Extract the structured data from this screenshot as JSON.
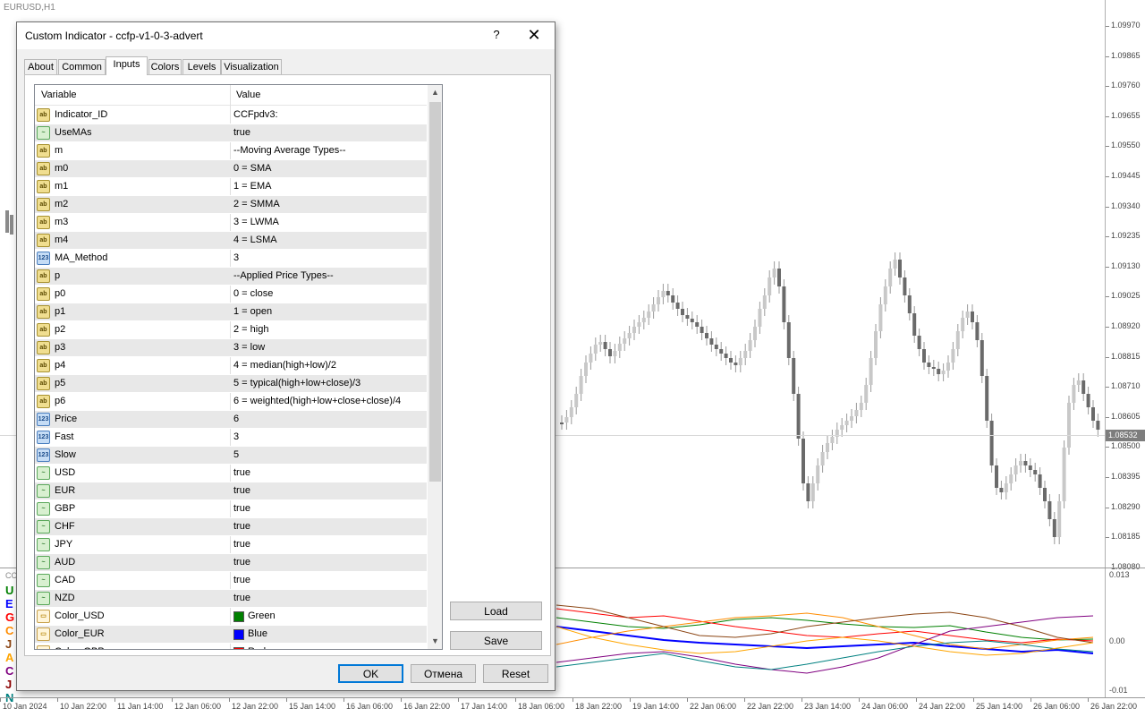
{
  "chart": {
    "symbol": "EURUSD,H1",
    "current_price": "1.08532",
    "price_ticks": [
      "1.09970",
      "1.09865",
      "1.09760",
      "1.09655",
      "1.09550",
      "1.09445",
      "1.09340",
      "1.09235",
      "1.09130",
      "1.09025",
      "1.08920",
      "1.08815",
      "1.08710",
      "1.08605",
      "1.08500",
      "1.08395",
      "1.08290",
      "1.08185",
      "1.08080"
    ],
    "subwindow_ticks": [
      "0.013",
      "0.00",
      "-0.01"
    ],
    "time_ticks": [
      "10 Jan 2024",
      "10 Jan 22:00",
      "11 Jan 14:00",
      "12 Jan 06:00",
      "12 Jan 22:00",
      "15 Jan 14:00",
      "16 Jan 06:00",
      "16 Jan 22:00",
      "17 Jan 14:00",
      "18 Jan 06:00",
      "18 Jan 22:00",
      "19 Jan 14:00",
      "22 Jan 06:00",
      "22 Jan 22:00",
      "23 Jan 14:00",
      "24 Jan 06:00",
      "24 Jan 22:00",
      "25 Jan 14:00",
      "26 Jan 06:00",
      "26 Jan 22:00"
    ],
    "ccfp_short": "CC",
    "currency_letters": [
      {
        "letter": "U",
        "color": "#008000"
      },
      {
        "letter": "E",
        "color": "#0000ff"
      },
      {
        "letter": "G",
        "color": "#ff0000"
      },
      {
        "letter": "C",
        "color": "#ff8c00"
      },
      {
        "letter": "J",
        "color": "#8b4513"
      },
      {
        "letter": "A",
        "color": "#ffa500"
      },
      {
        "letter": "C",
        "color": "#800080"
      },
      {
        "letter": "J",
        "color": "#8b0000"
      },
      {
        "letter": "N",
        "color": "#008080"
      }
    ]
  },
  "dialog": {
    "title": "Custom Indicator - ccfp-v1-0-3-advert",
    "help": "?",
    "close": "✕",
    "tabs": [
      "About",
      "Common",
      "Inputs",
      "Colors",
      "Levels",
      "Visualization"
    ],
    "active_tab": "Inputs",
    "columns": {
      "variable": "Variable",
      "value": "Value"
    },
    "rows": [
      {
        "type": "str",
        "icon": "ab",
        "var": "Indicator_ID",
        "val": "CCFpdv3:"
      },
      {
        "type": "bool",
        "icon": "~",
        "var": "UseMAs",
        "val": "true"
      },
      {
        "type": "str",
        "icon": "ab",
        "var": "m",
        "val": "--Moving Average Types--"
      },
      {
        "type": "str",
        "icon": "ab",
        "var": "m0",
        "val": " 0 = SMA"
      },
      {
        "type": "str",
        "icon": "ab",
        "var": "m1",
        "val": " 1 = EMA"
      },
      {
        "type": "str",
        "icon": "ab",
        "var": "m2",
        "val": " 2 = SMMA"
      },
      {
        "type": "str",
        "icon": "ab",
        "var": "m3",
        "val": " 3 = LWMA"
      },
      {
        "type": "str",
        "icon": "ab",
        "var": "m4",
        "val": " 4 = LSMA"
      },
      {
        "type": "int",
        "icon": "123",
        "var": "MA_Method",
        "val": "3"
      },
      {
        "type": "str",
        "icon": "ab",
        "var": "p",
        "val": "--Applied Price Types--"
      },
      {
        "type": "str",
        "icon": "ab",
        "var": "p0",
        "val": " 0 = close"
      },
      {
        "type": "str",
        "icon": "ab",
        "var": "p1",
        "val": " 1 = open"
      },
      {
        "type": "str",
        "icon": "ab",
        "var": "p2",
        "val": " 2 = high"
      },
      {
        "type": "str",
        "icon": "ab",
        "var": "p3",
        "val": " 3 = low"
      },
      {
        "type": "str",
        "icon": "ab",
        "var": "p4",
        "val": " 4 = median(high+low)/2"
      },
      {
        "type": "str",
        "icon": "ab",
        "var": "p5",
        "val": " 5 = typical(high+low+close)/3"
      },
      {
        "type": "str",
        "icon": "ab",
        "var": "p6",
        "val": " 6 = weighted(high+low+close+close)/4"
      },
      {
        "type": "int",
        "icon": "123",
        "var": "Price",
        "val": "6"
      },
      {
        "type": "int",
        "icon": "123",
        "var": "Fast",
        "val": "3"
      },
      {
        "type": "int",
        "icon": "123",
        "var": "Slow",
        "val": "5"
      },
      {
        "type": "bool",
        "icon": "~",
        "var": "USD",
        "val": "true"
      },
      {
        "type": "bool",
        "icon": "~",
        "var": "EUR",
        "val": "true"
      },
      {
        "type": "bool",
        "icon": "~",
        "var": "GBP",
        "val": "true"
      },
      {
        "type": "bool",
        "icon": "~",
        "var": "CHF",
        "val": "true"
      },
      {
        "type": "bool",
        "icon": "~",
        "var": "JPY",
        "val": "true"
      },
      {
        "type": "bool",
        "icon": "~",
        "var": "AUD",
        "val": "true"
      },
      {
        "type": "bool",
        "icon": "~",
        "var": "CAD",
        "val": "true"
      },
      {
        "type": "bool",
        "icon": "~",
        "var": "NZD",
        "val": "true"
      },
      {
        "type": "col",
        "icon": "▭",
        "var": "Color_USD",
        "val": "Green",
        "swatch": "#008000"
      },
      {
        "type": "col",
        "icon": "▭",
        "var": "Color_EUR",
        "val": "Blue",
        "swatch": "#0000ff"
      },
      {
        "type": "col",
        "icon": "▭",
        "var": "Color_GBP",
        "val": "Red",
        "swatch": "#ff0000"
      }
    ],
    "buttons": {
      "load": "Load",
      "save": "Save",
      "ok": "OK",
      "cancel": "Отмена",
      "reset": "Reset"
    }
  }
}
